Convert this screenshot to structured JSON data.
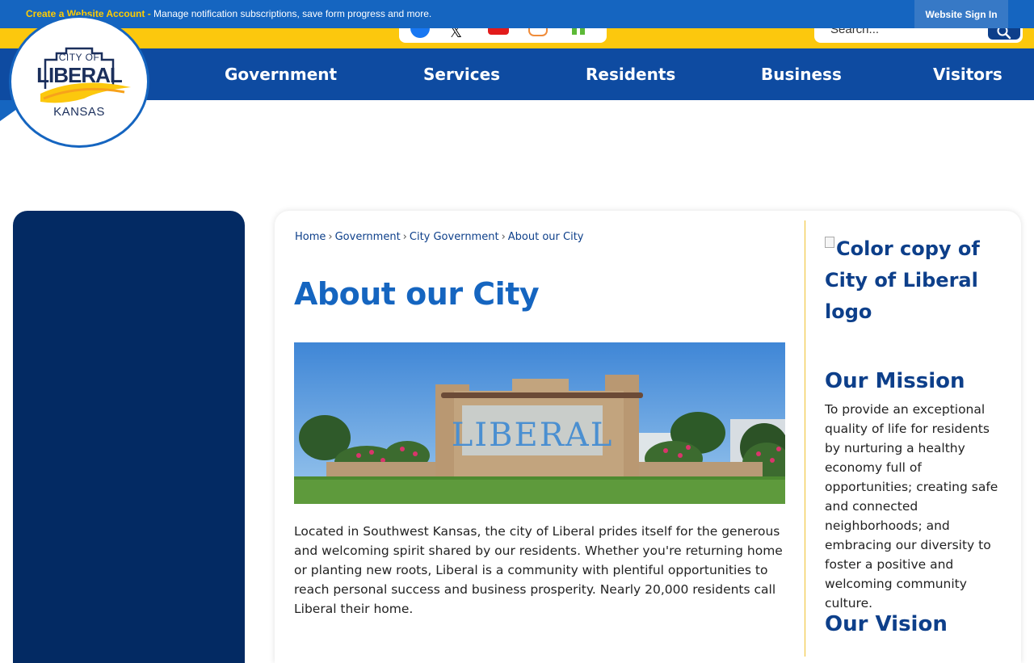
{
  "topbar": {
    "link_text": "Create a Website Account",
    "separator": " - ",
    "message": "Manage notification subscriptions, save form progress and more.",
    "signin_label": "Website Sign In"
  },
  "social": [
    "facebook-icon",
    "x-icon",
    "youtube-icon",
    "instagram-icon",
    "nextdoor-icon"
  ],
  "search": {
    "placeholder": "Search..."
  },
  "logo": {
    "line1": "CITY OF",
    "line2": "LIBERAL",
    "line3": "KANSAS"
  },
  "nav": {
    "items": [
      {
        "label": "Government"
      },
      {
        "label": "Services"
      },
      {
        "label": "Residents"
      },
      {
        "label": "Business"
      },
      {
        "label": "Visitors"
      }
    ]
  },
  "breadcrumb": {
    "items": [
      "Home",
      "Government",
      "City Government",
      "About our City"
    ],
    "separator": "›"
  },
  "main": {
    "title": "About our City",
    "hero_sign_text": "LIBERAL",
    "paragraph": "Located in Southwest Kansas, the city of Liberal prides itself for the generous and welcoming spirit shared by our residents. Whether you're returning home or planting new roots, Liberal is a community with plentiful opportunities to reach personal success and business prosperity. Nearly 20,000 residents call Liberal their home."
  },
  "aside": {
    "logo_alt": "Color copy of City of Liberal logo",
    "mission_heading": "Our Mission",
    "mission_text": "To provide an exceptional quality of life for residents by nurturing a healthy economy full of opportunities; creating safe and connected neighborhoods; and embracing our diversity to foster a positive and welcoming community culture.",
    "vision_heading": "Our Vision"
  },
  "colors": {
    "topbar": "#1565c0",
    "accent_yellow": "#fcc80d",
    "nav": "#0e4ba1",
    "sidebar": "#032a63",
    "title_blue": "#1565c0"
  }
}
